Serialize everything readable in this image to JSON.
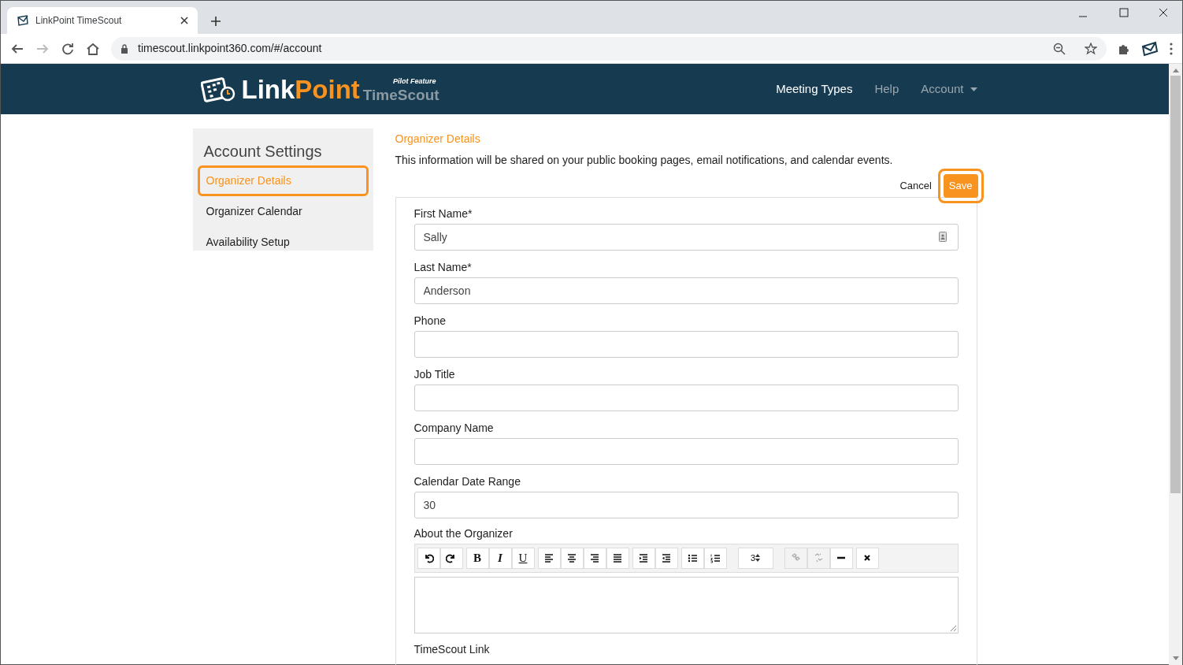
{
  "browser": {
    "tab_title": "LinkPoint TimeScout",
    "url": "timescout.linkpoint360.com/#/account"
  },
  "header": {
    "logo": {
      "part_1": "Link",
      "part_2": "Point",
      "part_3": "TimeScout",
      "tag": "Pilot Feature"
    },
    "nav": [
      {
        "label": "Meeting Types",
        "selected": true,
        "dropdown": false
      },
      {
        "label": "Help",
        "selected": false,
        "dropdown": false
      },
      {
        "label": "Account",
        "selected": false,
        "dropdown": true
      }
    ]
  },
  "sidebar": {
    "title": "Account Settings",
    "items": [
      {
        "label": "Organizer Details",
        "selected": true,
        "highlighted": true
      },
      {
        "label": "Organizer Calendar",
        "selected": false,
        "highlighted": false
      },
      {
        "label": "Availability Setup",
        "selected": false,
        "highlighted": false
      }
    ]
  },
  "main": {
    "title": "Organizer Details",
    "description": "This information will be shared on your public booking pages, email notifications, and calendar events.",
    "cancel": "Cancel",
    "save": {
      "label": "Save",
      "highlighted": true
    },
    "fields": [
      {
        "label": "First Name*",
        "value": "Sally",
        "autofill_icon": true
      },
      {
        "label": "Last Name*",
        "value": "Anderson",
        "autofill_icon": false
      },
      {
        "label": "Phone",
        "autofill_icon": false
      },
      {
        "label": "Job Title",
        "autofill_icon": false
      },
      {
        "label": "Company Name",
        "autofill_icon": false
      },
      {
        "label": "Calendar Date Range",
        "value": "30",
        "autofill_icon": false
      }
    ],
    "editor": {
      "label": "About the Organizer",
      "toolbar": [
        [
          {
            "kind": "undo",
            "disabled": false
          },
          {
            "kind": "redo",
            "disabled": false
          }
        ],
        [
          {
            "kind": "bold",
            "text": "B",
            "disabled": false
          },
          {
            "kind": "italic",
            "text": "I",
            "disabled": false
          },
          {
            "kind": "underline",
            "text": "U",
            "disabled": false
          }
        ],
        [
          {
            "kind": "align-left",
            "disabled": false
          },
          {
            "kind": "align-center",
            "disabled": false
          },
          {
            "kind": "align-right",
            "disabled": false
          },
          {
            "kind": "justify",
            "disabled": false
          }
        ],
        [
          {
            "kind": "indent",
            "disabled": false
          },
          {
            "kind": "outdent",
            "disabled": false
          }
        ],
        [
          {
            "kind": "bullet-list",
            "disabled": false
          },
          {
            "kind": "numbered-list",
            "disabled": false
          }
        ],
        [
          {
            "kind": "font-size",
            "text": "3",
            "disabled": false
          }
        ],
        [
          {
            "kind": "link",
            "disabled": true
          },
          {
            "kind": "unlink",
            "disabled": true
          },
          {
            "kind": "horizontal-rule",
            "disabled": false
          }
        ],
        [
          {
            "kind": "clear",
            "disabled": false
          }
        ]
      ]
    },
    "next_label": "TimeScout Link"
  }
}
